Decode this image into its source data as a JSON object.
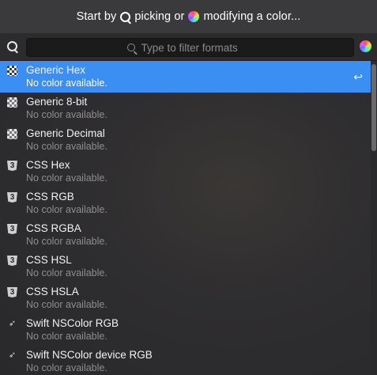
{
  "header": {
    "part1": "Start by",
    "part2": "picking or",
    "part3": "modifying a color..."
  },
  "search": {
    "placeholder": "Type to filter formats",
    "value": ""
  },
  "formats": [
    {
      "name": "Generic Hex",
      "status": "No color available.",
      "icon": "checkerboard-icon",
      "selected": true
    },
    {
      "name": "Generic 8-bit",
      "status": "No color available.",
      "icon": "checkerboard-icon"
    },
    {
      "name": "Generic Decimal",
      "status": "No color available.",
      "icon": "checkerboard-icon"
    },
    {
      "name": "CSS Hex",
      "status": "No color available.",
      "icon": "css3-icon"
    },
    {
      "name": "CSS RGB",
      "status": "No color available.",
      "icon": "css3-icon"
    },
    {
      "name": "CSS RGBA",
      "status": "No color available.",
      "icon": "css3-icon"
    },
    {
      "name": "CSS HSL",
      "status": "No color available.",
      "icon": "css3-icon"
    },
    {
      "name": "CSS HSLA",
      "status": "No color available.",
      "icon": "css3-icon"
    },
    {
      "name": "Swift NSColor RGB",
      "status": "No color available.",
      "icon": "swift-icon"
    },
    {
      "name": "Swift NSColor device RGB",
      "status": "No color available.",
      "icon": "swift-icon"
    }
  ],
  "selected_row": {
    "return_glyph": "↩"
  },
  "colors": {
    "selection": "#3b8ef2",
    "background": "#2a2a2c"
  }
}
